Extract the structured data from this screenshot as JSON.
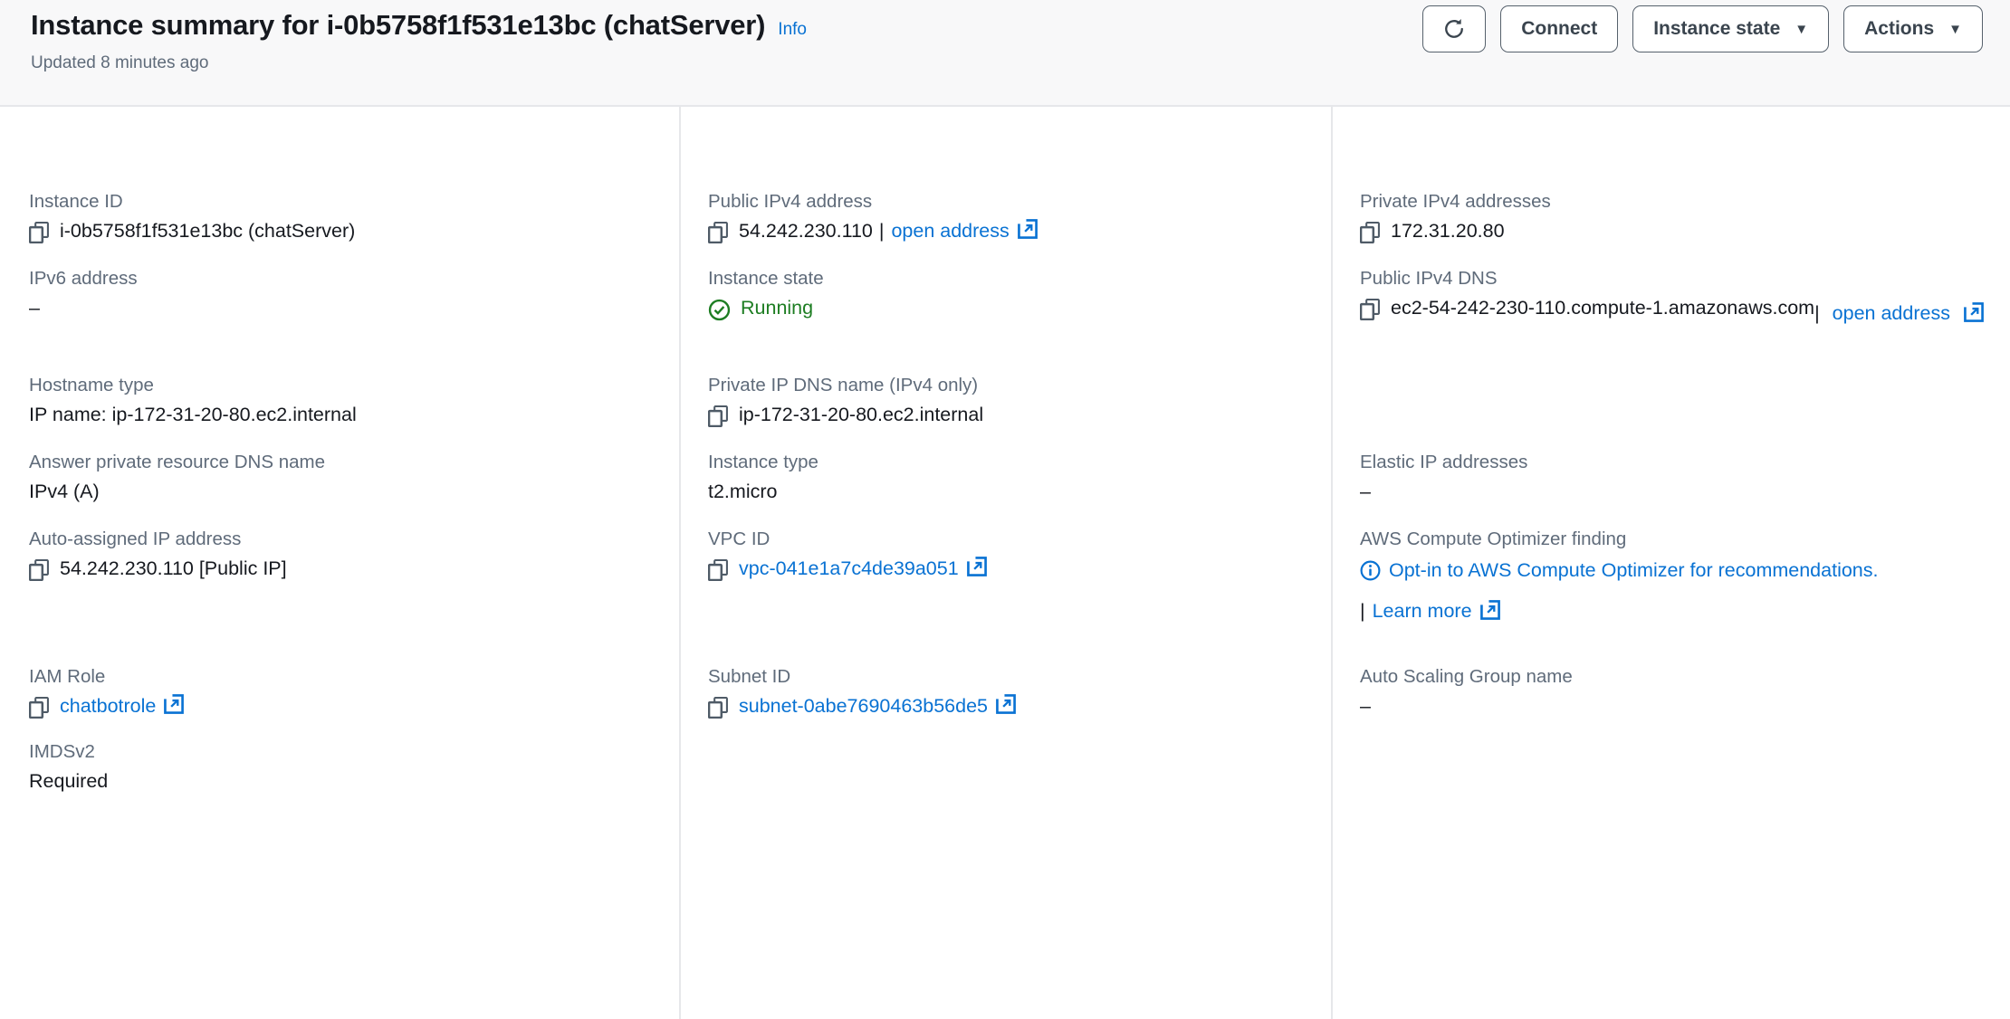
{
  "header": {
    "title": "Instance summary for i-0b5758f1f531e13bc (chatServer)",
    "info_label": "Info",
    "updated_text": "Updated 8 minutes ago",
    "buttons": {
      "refresh_icon": "refresh-icon",
      "connect_label": "Connect",
      "instance_state_label": "Instance state",
      "actions_label": "Actions",
      "caret": "▼"
    },
    "colors": {
      "link": "#0972d3",
      "header_bg": "#f8f8f9",
      "border": "#e6e7ea"
    }
  },
  "columns": {
    "col1": [
      {
        "label": "Instance ID",
        "value": "i-0b5758f1f531e13bc (chatServer)",
        "copy": true
      },
      {
        "label": "IPv6 address",
        "value": "–",
        "copy": false
      },
      {
        "label": "Hostname type",
        "value": "IP name: ip-172-31-20-80.ec2.internal",
        "copy": false
      },
      {
        "label": "Answer private resource DNS name",
        "value": "IPv4 (A)",
        "copy": false
      },
      {
        "label": "Auto-assigned IP address",
        "value": "54.242.230.110 [Public IP]",
        "copy": true
      },
      {
        "label": "IAM Role",
        "value": "chatbotrole",
        "copy": true,
        "is_link": true,
        "external": true
      },
      {
        "label": "IMDSv2",
        "value": "Required",
        "copy": false
      }
    ],
    "col2": [
      {
        "label": "Public IPv4 address",
        "value": "54.242.230.110",
        "copy": true,
        "separator": "|",
        "link_label": "open address",
        "external": true
      },
      {
        "label": "Instance state",
        "value": "Running",
        "status": "running",
        "status_color": "#1d7d22"
      },
      {
        "label": "Private IP DNS name (IPv4 only)",
        "value": "ip-172-31-20-80.ec2.internal",
        "copy": true
      },
      {
        "label": "Instance type",
        "value": "t2.micro",
        "copy": false
      },
      {
        "label": "VPC ID",
        "value": "vpc-041e1a7c4de39a051",
        "copy": true,
        "is_link": true,
        "external": true
      },
      {
        "label": "Subnet ID",
        "value": "subnet-0abe7690463b56de5",
        "copy": true,
        "is_link": true,
        "external": true
      }
    ],
    "col3": [
      {
        "label": "Private IPv4 addresses",
        "value": "172.31.20.80",
        "copy": true
      },
      {
        "label": "Public IPv4 DNS",
        "value": "ec2-54-242-230-110.compute-1.amazonaws.com",
        "copy": true,
        "separator": "|",
        "link_label": "open address",
        "external": true
      },
      {
        "label": "Elastic IP addresses",
        "value": "–",
        "copy": false
      },
      {
        "label": "AWS Compute Optimizer finding",
        "value": "Opt-in to AWS Compute Optimizer for recommendations.",
        "info": true,
        "separator": "|",
        "link_label": "Learn more",
        "external": true
      },
      {
        "label": "Auto Scaling Group name",
        "value": "–",
        "copy": false
      }
    ]
  },
  "icons": {
    "copy": "copy-icon",
    "external_link": "external-link-icon",
    "status_ok": "check-circle-icon",
    "info_circle": "info-circle-icon"
  }
}
